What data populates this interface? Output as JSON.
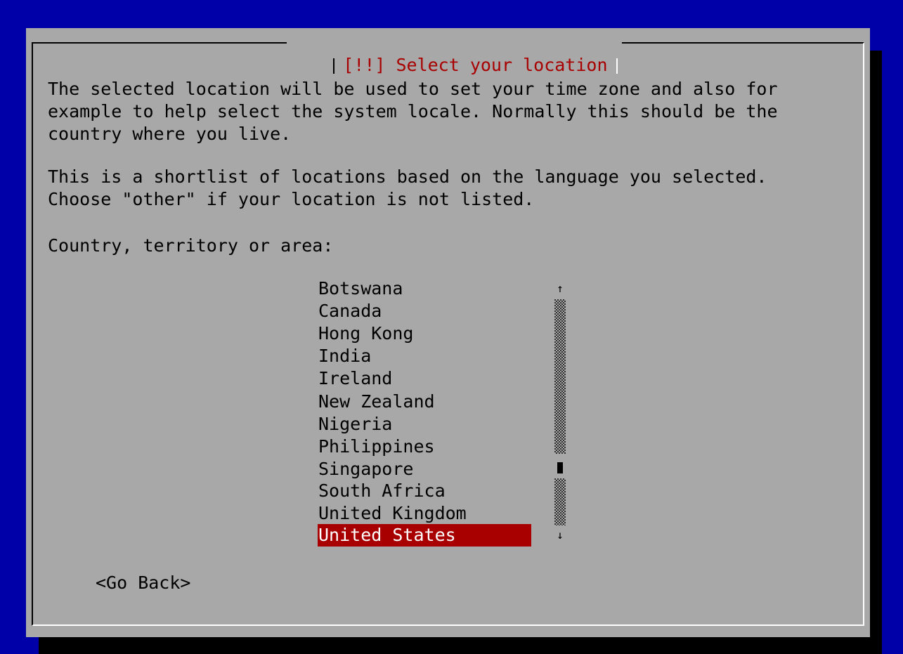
{
  "dialog": {
    "title": "[!!] Select your location",
    "description_lines": [
      "The selected location will be used to set your time zone and also for",
      "example to help select the system locale. Normally this should be the",
      "country where you live."
    ],
    "shortlist_lines": [
      "This is a shortlist of locations based on the language you selected.",
      "Choose \"other\" if your location is not listed."
    ],
    "prompt": "Country, territory or area:"
  },
  "location_list": {
    "items": [
      {
        "label": "Botswana"
      },
      {
        "label": "Canada"
      },
      {
        "label": "Hong Kong"
      },
      {
        "label": "India"
      },
      {
        "label": "Ireland"
      },
      {
        "label": "New Zealand"
      },
      {
        "label": "Nigeria"
      },
      {
        "label": "Philippines"
      },
      {
        "label": "Singapore"
      },
      {
        "label": "South Africa"
      },
      {
        "label": "United Kingdom"
      },
      {
        "label": "United States"
      }
    ],
    "selected": "United States",
    "scroll_up_glyph": "↑",
    "scroll_down_glyph": "↓"
  },
  "buttons": {
    "go_back": "<Go Back>"
  },
  "colors": {
    "background": "#0000a8",
    "dialog": "#a8a8a8",
    "title_text": "#a80000",
    "selection": "#a80000",
    "selection_text": "#ffffff"
  }
}
